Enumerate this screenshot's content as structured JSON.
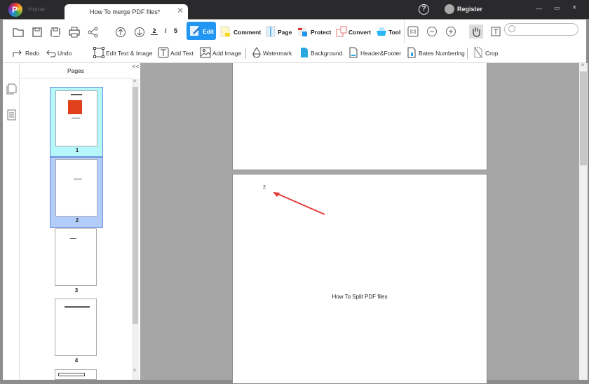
{
  "titlebar": {
    "home_tab": "Home",
    "doc_tab": "How To merge PDF files*",
    "register": "Register",
    "help": "?",
    "minimize": "—",
    "maximize": "▭",
    "close": "×"
  },
  "toolbar": {
    "current_page": "2",
    "page_sep": "/",
    "total_pages": "5",
    "edit": "Edit",
    "comment": "Comment",
    "page": "Page",
    "protect": "Protect",
    "convert": "Convert",
    "tool": "Tool",
    "search_placeholder": ""
  },
  "edit_toolbar": {
    "redo": "Redo",
    "undo": "Undo",
    "edit_text_image": "Edit Text & Image",
    "add_text": "Add Text",
    "add_image": "Add Image",
    "watermark": "Watermark",
    "background": "Background",
    "header_footer": "Header&Footer",
    "bates": "Bates Numbering",
    "crop": "Crop"
  },
  "pages_panel": {
    "title": "Pages",
    "collapse": "<<",
    "thumbnails": [
      {
        "num": "1"
      },
      {
        "num": "2"
      },
      {
        "num": "3"
      },
      {
        "num": "4"
      }
    ]
  },
  "document": {
    "page_number_text": "2",
    "page_title": "How To Split PDF files"
  },
  "colors": {
    "accent": "#2196f3",
    "selected_thumb": "#b3cdfa",
    "hover_thumb": "#b5f7fb",
    "arrow": "#e53935"
  }
}
